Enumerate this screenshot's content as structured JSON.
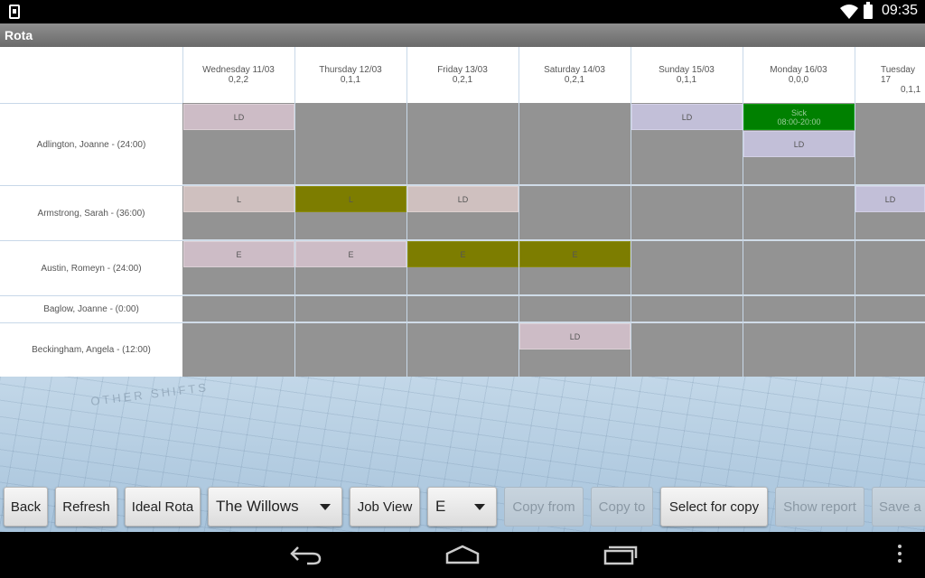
{
  "status_bar": {
    "time": "09:35",
    "icons": [
      "download-notification-icon",
      "wifi-icon",
      "battery-icon"
    ]
  },
  "app": {
    "title": "Rota"
  },
  "days": [
    {
      "date": "Wednesday 11/03",
      "counts": "0,2,2"
    },
    {
      "date": "Thursday 12/03",
      "counts": "0,1,1"
    },
    {
      "date": "Friday 13/03",
      "counts": "0,2,1"
    },
    {
      "date": "Saturday 14/03",
      "counts": "0,2,1"
    },
    {
      "date": "Sunday 15/03",
      "counts": "0,1,1"
    },
    {
      "date": "Monday 16/03",
      "counts": "0,0,0"
    },
    {
      "date": "Tuesday 17",
      "counts": "0,1,1"
    }
  ],
  "staff": [
    "Adlington, Joanne - (24:00)",
    "Armstrong, Sarah - (36:00)",
    "Austin, Romeyn - (24:00)",
    "Baglow, Joanne - (0:00)",
    "Beckingham, Angela - (12:00)"
  ],
  "shifts": {
    "adlington_wed": "LD",
    "adlington_sun": "LD",
    "adlington_mon_sick": "Sick",
    "adlington_mon_sick_time": "08:00-20:00",
    "adlington_mon_ld": "LD",
    "armstrong_wed": "L",
    "armstrong_thu": "L",
    "armstrong_fri": "LD",
    "armstrong_tue": "LD",
    "austin_wed": "E",
    "austin_thu": "E",
    "austin_fri": "E",
    "austin_sat": "E",
    "beckingham_sat": "LD"
  },
  "background": {
    "watermark": "OTHER SHIFTS"
  },
  "toolbar": {
    "back": "Back",
    "refresh": "Refresh",
    "ideal_rota": "Ideal Rota",
    "location_value": "The Willows",
    "job_view": "Job View",
    "job_value": "E",
    "copy_from": "Copy from",
    "copy_to": "Copy to",
    "select_for_copy": "Select for copy",
    "show_report": "Show report",
    "save": "Save a"
  },
  "colors": {
    "olive_shift": "#7d7d00",
    "sick_shift": "#008000",
    "empty_cell": "#939393",
    "pale_shift": "#b9b4c8"
  },
  "nav_bar": {
    "icons": [
      "back-nav-icon",
      "home-nav-icon",
      "recent-apps-icon",
      "overflow-menu-icon"
    ]
  }
}
